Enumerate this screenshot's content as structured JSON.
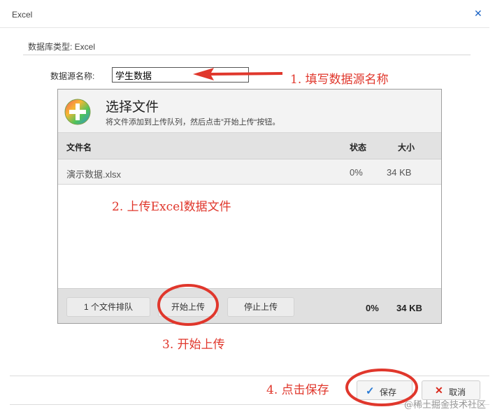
{
  "dialog": {
    "title": "Excel",
    "close_icon": "close-icon",
    "db_type_label": "数据库类型: Excel",
    "datasource_label": "数据源名称:",
    "datasource_value": "学生数据"
  },
  "uploader": {
    "icon": "add-file-icon",
    "title": "选择文件",
    "subtitle": "将文件添加到上传队列，然后点击”开始上传“按钮。",
    "columns": {
      "filename": "文件名",
      "status": "状态",
      "size": "大小"
    },
    "files": [
      {
        "name": "演示数据.xlsx",
        "status": "0%",
        "size": "34 KB"
      }
    ],
    "footer": {
      "queue_label": "1 个文件排队",
      "start_label": "开始上传",
      "stop_label": "停止上传",
      "total_percent": "0%",
      "total_size": "34 KB"
    }
  },
  "actions": {
    "save_label": "保存",
    "save_icon": "checkmark-icon",
    "cancel_label": "取消",
    "cancel_icon": "x-icon"
  },
  "annotations": {
    "step1": "1. 填写数据源名称",
    "step2": "2. 上传Excel数据文件",
    "step3": "3. 开始上传",
    "step4": "4. 点击保存"
  },
  "watermark": "@稀土掘金技术社区",
  "colors": {
    "annotation_red": "#e0372c",
    "close_blue": "#1c64c5",
    "save_check_blue": "#2a7bd5",
    "cancel_x_red": "#d9291c"
  }
}
